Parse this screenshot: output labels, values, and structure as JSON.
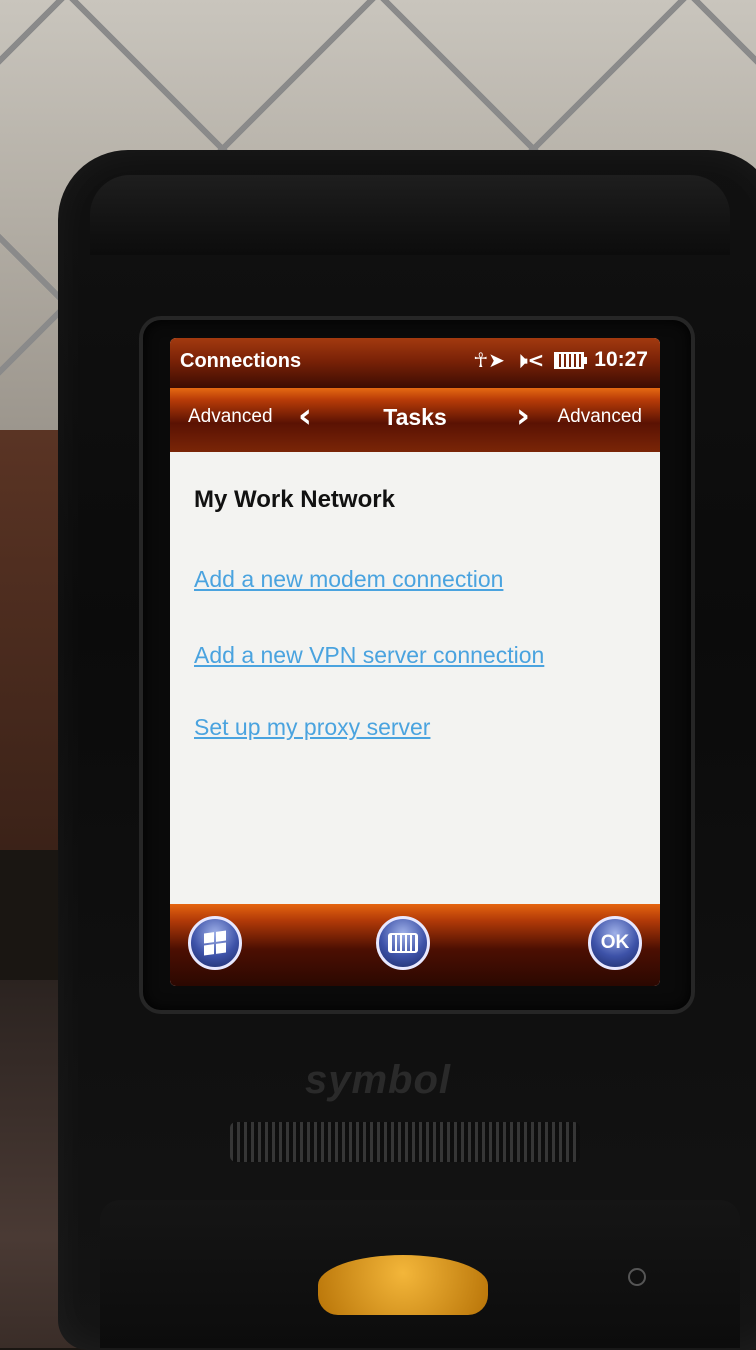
{
  "status_bar": {
    "app_title": "Connections",
    "time": "10:27",
    "icons": [
      "connectivity-icon",
      "speaker-muted-icon",
      "battery-icon"
    ]
  },
  "tab_bar": {
    "left_label": "Advanced",
    "center_label": "Tasks",
    "right_label": "Advanced"
  },
  "content": {
    "section_title": "My Work Network",
    "links": [
      "Add a new modem connection",
      "Add a new VPN server connection",
      "Set up my proxy server"
    ]
  },
  "softkeys": {
    "start_icon": "windows-start-icon",
    "keyboard_icon": "keyboard-icon",
    "ok_label": "OK"
  },
  "device": {
    "brand": "symbol"
  }
}
